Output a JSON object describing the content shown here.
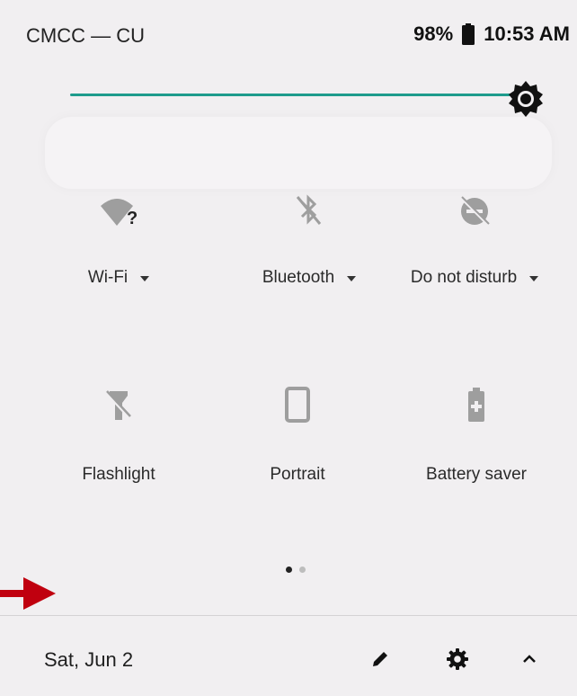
{
  "status_bar": {
    "carrier": "CMCC — CU",
    "battery_pct": "98%",
    "time": "10:53 AM"
  },
  "brightness": {
    "level_fraction": 1.0
  },
  "tiles_row1": [
    {
      "label": "Wi-Fi",
      "icon": "wifi-unknown-icon",
      "has_dropdown": true
    },
    {
      "label": "Bluetooth",
      "icon": "bluetooth-off-icon",
      "has_dropdown": true
    },
    {
      "label": "Do not disturb",
      "icon": "do-not-disturb-off-icon",
      "has_dropdown": true
    }
  ],
  "tiles_row2": [
    {
      "label": "Flashlight",
      "icon": "flashlight-off-icon"
    },
    {
      "label": "Portrait",
      "icon": "portrait-icon"
    },
    {
      "label": "Battery saver",
      "icon": "battery-saver-icon"
    }
  ],
  "pager": {
    "pages": 2,
    "current": 1
  },
  "footer": {
    "date": "Sat, Jun 2",
    "icons": [
      "edit-icon",
      "settings-icon",
      "chevron-up-icon"
    ]
  },
  "colors": {
    "accent": "#1e9b8c",
    "annotation_arrow": "#c0000f",
    "background": "#f1eff1"
  }
}
